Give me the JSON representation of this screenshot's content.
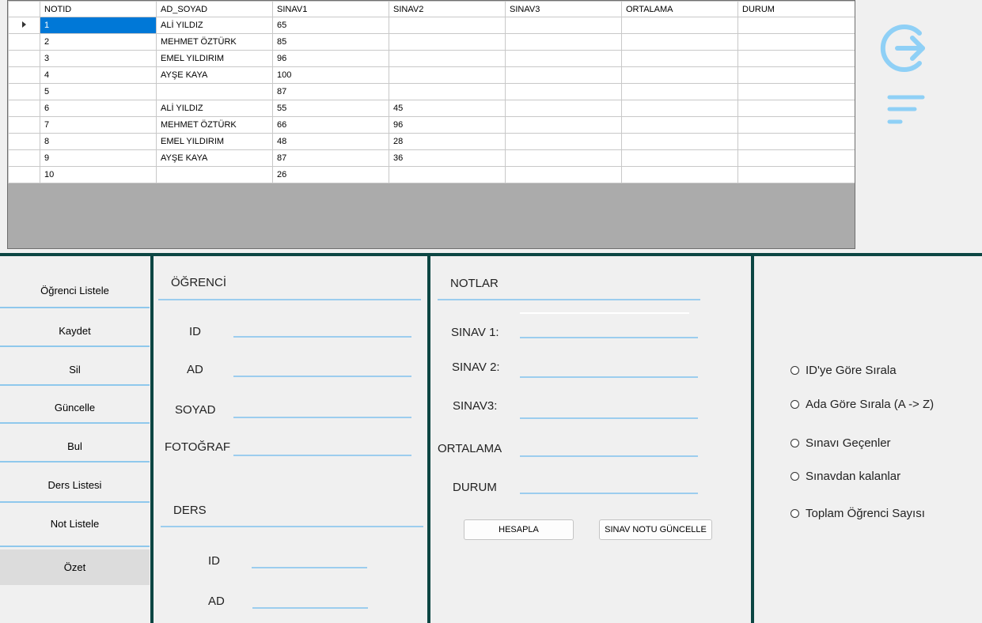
{
  "grid": {
    "columns": [
      "NOTID",
      "AD_SOYAD",
      "SINAV1",
      "SINAV2",
      "SINAV3",
      "ORTALAMA",
      "DURUM"
    ],
    "rows": [
      [
        "1",
        "ALİ YILDIZ",
        "65",
        "",
        "",
        "",
        ""
      ],
      [
        "2",
        "MEHMET ÖZTÜRK",
        "85",
        "",
        "",
        "",
        ""
      ],
      [
        "3",
        "EMEL YILDIRIM",
        "96",
        "",
        "",
        "",
        ""
      ],
      [
        "4",
        "AYŞE KAYA",
        "100",
        "",
        "",
        "",
        ""
      ],
      [
        "5",
        "",
        "87",
        "",
        "",
        "",
        ""
      ],
      [
        "6",
        "ALİ YILDIZ",
        "55",
        "45",
        "",
        "",
        ""
      ],
      [
        "7",
        "MEHMET ÖZTÜRK",
        "66",
        "96",
        "",
        "",
        ""
      ],
      [
        "8",
        "EMEL YILDIRIM",
        "48",
        "28",
        "",
        "",
        ""
      ],
      [
        "9",
        "AYŞE KAYA",
        "87",
        "36",
        "",
        "",
        ""
      ],
      [
        "10",
        "",
        "26",
        "",
        "",
        "",
        ""
      ]
    ],
    "selected_row": 0
  },
  "icons": {
    "exit": "exit-arrow-circle-icon",
    "filter": "filter-lines-icon",
    "accent": "#8fd0f6"
  },
  "menu": {
    "items": [
      {
        "label": "Öğrenci Listele"
      },
      {
        "label": "Kaydet"
      },
      {
        "label": "Sil"
      },
      {
        "label": "Güncelle"
      },
      {
        "label": "Bul"
      },
      {
        "label": "Ders Listesi"
      },
      {
        "label": "Not Listele"
      },
      {
        "label": "Özet"
      }
    ],
    "active_index": 7
  },
  "ogrenci": {
    "title": "ÖĞRENCİ",
    "id_label": "ID",
    "ad_label": "AD",
    "soyad_label": "SOYAD",
    "foto_label": "FOTOĞRAF"
  },
  "ders": {
    "title": "DERS",
    "id_label": "ID",
    "ad_label": "AD"
  },
  "notlar": {
    "title": "NOTLAR",
    "sinav1_label": "SINAV 1:",
    "sinav2_label": "SINAV 2:",
    "sinav3_label": "SINAV3:",
    "ortalama_label": "ORTALAMA",
    "durum_label": "DURUM",
    "hesapla_label": "HESAPLA",
    "guncelle_label": "SINAV NOTU GÜNCELLE"
  },
  "radios": [
    {
      "label": "ID'ye Göre Sırala"
    },
    {
      "label": "Ada Göre Sırala (A -> Z)"
    },
    {
      "label": "Sınavı Geçenler"
    },
    {
      "label": "Sınavdan kalanlar"
    },
    {
      "label": "Toplam Öğrenci Sayısı"
    }
  ],
  "colors": {
    "divider": "#0c4643",
    "underline": "#9ccdee",
    "selection": "#0078d7"
  }
}
